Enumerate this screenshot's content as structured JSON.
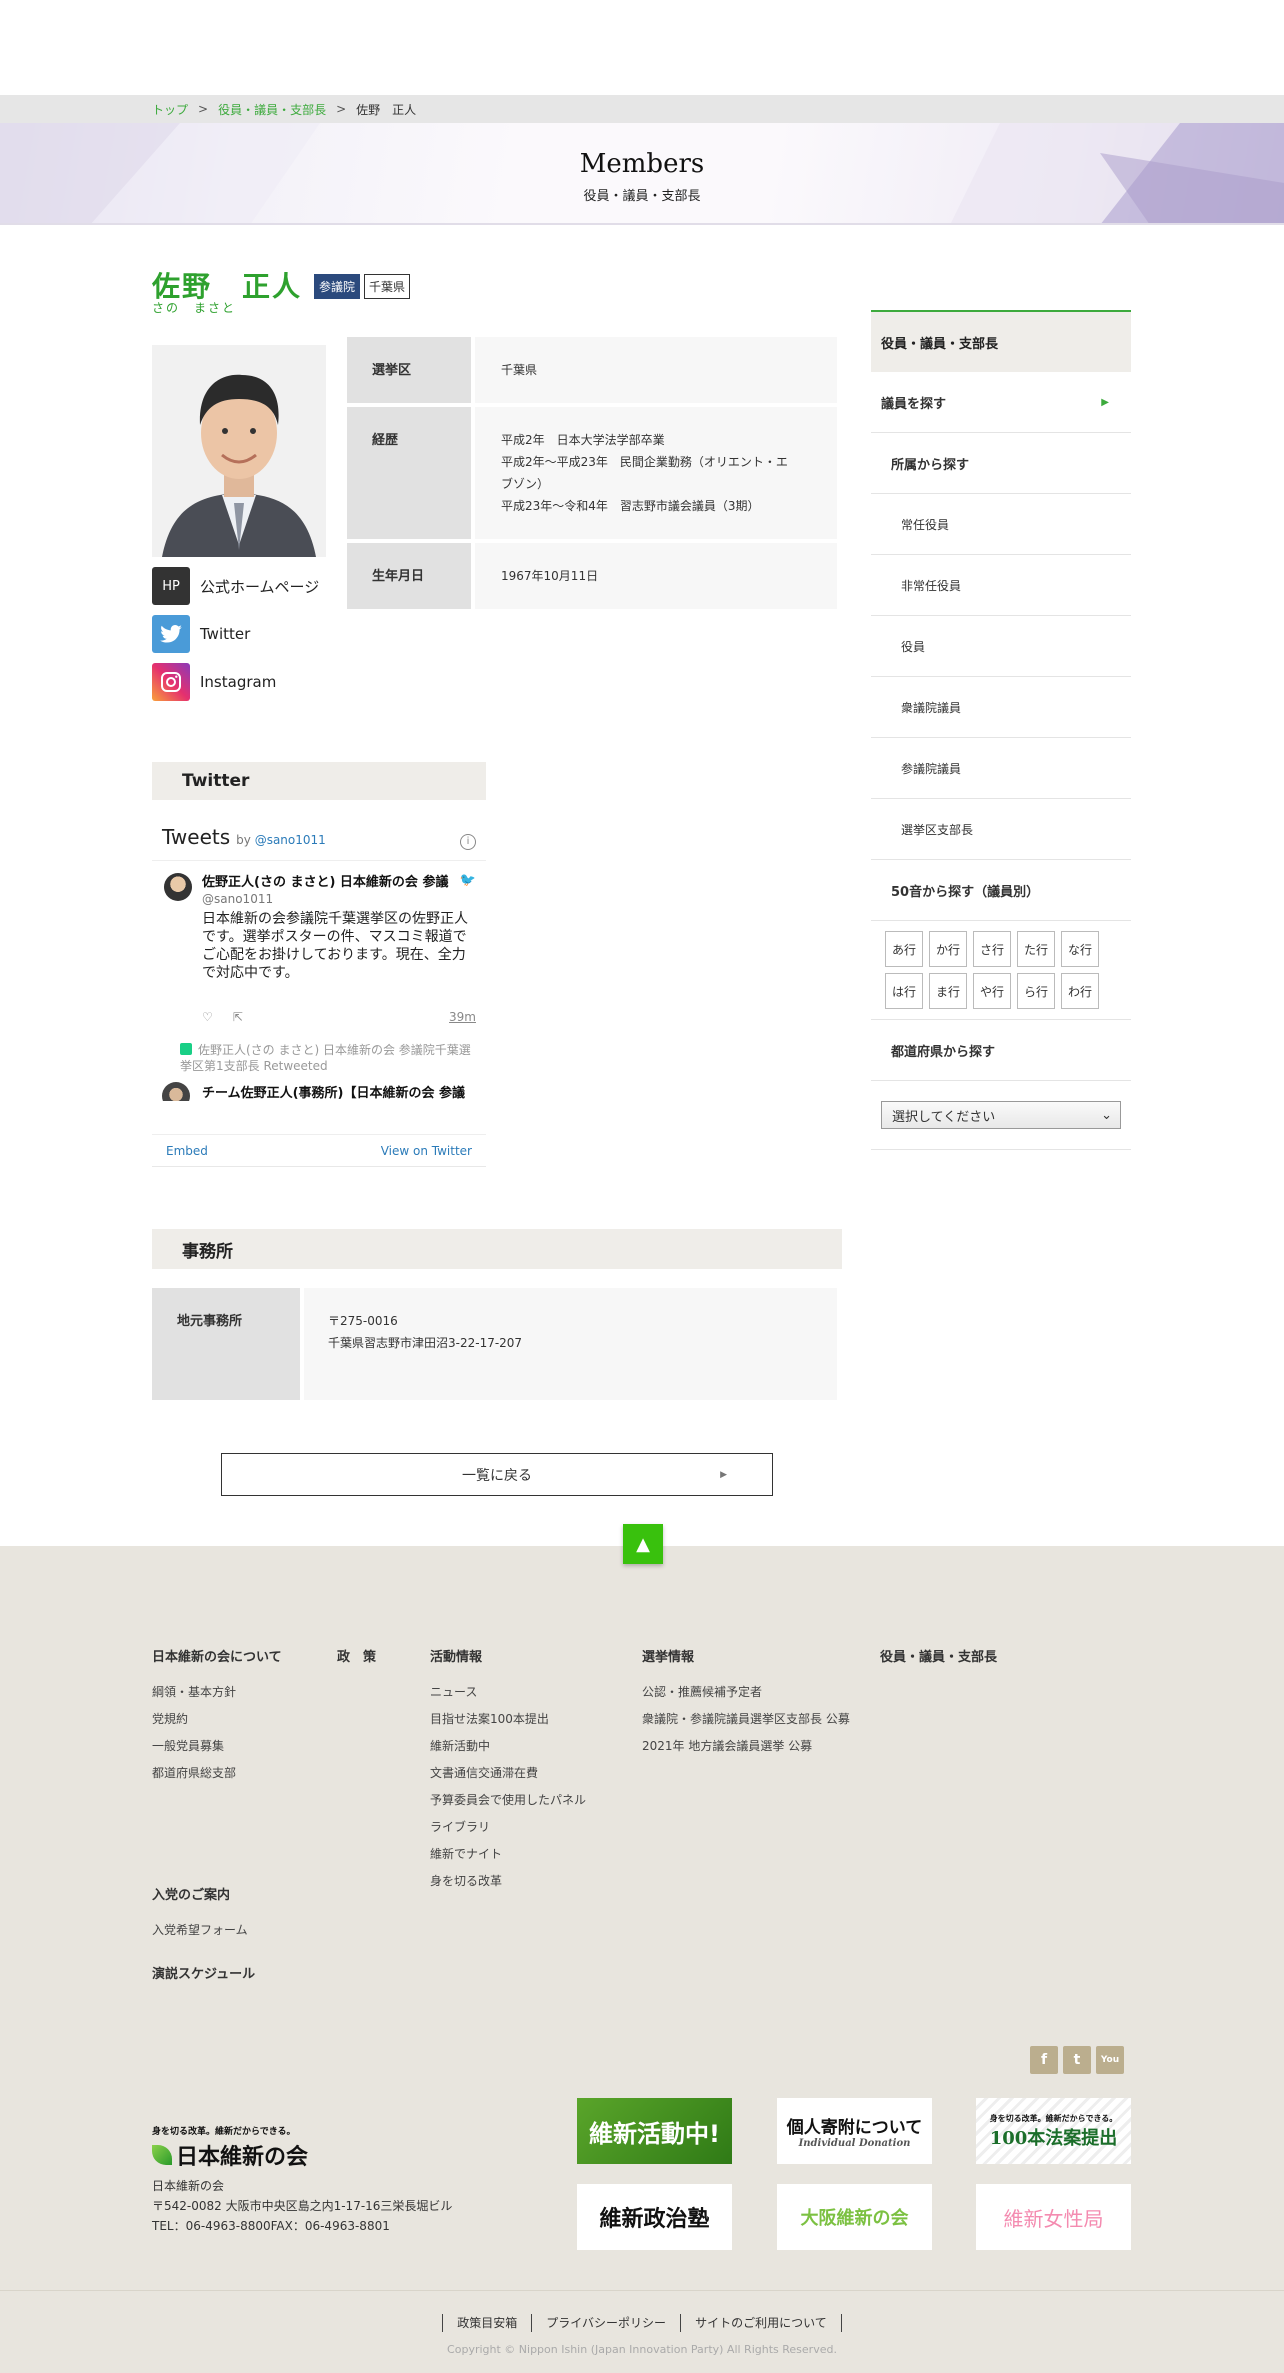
{
  "breadcrumb": {
    "home": "トップ",
    "section": "役員・議員・支部長",
    "current": "佐野　正人",
    "sep": ">"
  },
  "hero": {
    "title": "Members",
    "subtitle": "役員・議員・支部長"
  },
  "profile": {
    "name": "佐野　正人",
    "kana": "さの　まさと",
    "badge_house": "参議院",
    "badge_pref": "千葉県",
    "rows": [
      {
        "label": "選挙区",
        "value": [
          "千葉県"
        ]
      },
      {
        "label": "経歴",
        "value": [
          "平成2年　日本大学法学部卒業",
          "平成2年～平成23年　民間企業勤務（オリエント・エ",
          "ブゾン）",
          "平成23年～令和4年　習志野市議会議員（3期）"
        ]
      },
      {
        "label": "生年月日",
        "value": [
          "1967年10月11日"
        ]
      }
    ],
    "links": [
      {
        "label": "公式ホームページ",
        "icon_text": "HP",
        "color": "#333333"
      },
      {
        "label": "Twitter",
        "icon_text": "🐦",
        "color": "#4a9bd8"
      },
      {
        "label": "Instagram",
        "icon_text": "◎",
        "color": "#c13584"
      }
    ]
  },
  "twitter": {
    "heading": "Twitter",
    "widget_title": "Tweets",
    "by": "by",
    "handle_link": "@sano1011",
    "tweet1": {
      "name": "佐野正人(さの まさと) 日本維新の会 参議",
      "handle": "@sano1011",
      "text": "日本維新の会参議院千葉選挙区の佐野正人です。選挙ポスターの件、マスコミ報道でご心配をお掛けしております。現在、全力で対応中です。",
      "time": "39m"
    },
    "retweet_note": "佐野正人(さの まさと) 日本維新の会 参議院千葉選挙区第1支部長 Retweeted",
    "tweet2_name": "チーム佐野正人(事務所)【日本維新の会 参議",
    "embed": "Embed",
    "view": "View on Twitter"
  },
  "office": {
    "heading": "事務所",
    "label": "地元事務所",
    "postal": "〒275-0016",
    "address": "千葉県習志野市津田沼3-22-17-207"
  },
  "back_button": "一覧に戻る",
  "sidebar": {
    "title": "役員・議員・支部長",
    "search": "議員を探す",
    "by_affiliation": "所属から探す",
    "affiliations": [
      "常任役員",
      "非常任役員",
      "役員",
      "衆議院議員",
      "参議院議員",
      "選挙区支部長"
    ],
    "by_kana": "50音から探す（議員別）",
    "kana": [
      "あ行",
      "か行",
      "さ行",
      "た行",
      "な行",
      "は行",
      "ま行",
      "や行",
      "ら行",
      "わ行"
    ],
    "by_pref": "都道府県から探す",
    "select_placeholder": "選択してください"
  },
  "footer": {
    "col1_title": "日本維新の会について",
    "col1": [
      "綱領・基本方針",
      "党規約",
      "一般党員募集",
      "都道府県総支部"
    ],
    "col2_title": "政　策",
    "col3_title": "活動情報",
    "col3": [
      "ニュース",
      "目指せ法案100本提出",
      "維新活動中",
      "文書通信交通滞在費",
      "予算委員会で使用したパネル",
      "ライブラリ",
      "維新でナイト",
      "身を切る改革"
    ],
    "col4_title": "選挙情報",
    "col4": [
      "公認・推薦候補予定者",
      "衆議院・参議院議員選挙区支部長 公募",
      "2021年 地方議会議員選挙 公募"
    ],
    "col5_title": "役員・議員・支部長",
    "join_title": "入党のご案内",
    "join_link": "入党希望フォーム",
    "speech_title": "演説スケジュール",
    "social": [
      "f",
      "t",
      "You"
    ],
    "logo_tagline": "身を切る改革。維新だからできる。",
    "logo_name": "日本維新の会",
    "org": "日本維新の会",
    "address": "〒542-0082 大阪市中央区島之内1-17-16三栄長堀ビル",
    "tel": "TEL：06-4963-8800FAX：06-4963-8801",
    "banners": [
      "維新活動中!",
      "個人寄附について",
      "Individual Donation",
      "身を切る改革。維新だからできる。",
      "100本法案提出",
      "維新政治塾",
      "大阪維新の会",
      "維新女性局"
    ],
    "bottom_links": [
      "政策目安箱",
      "プライバシーポリシー",
      "サイトのご利用について"
    ],
    "copyright": "Copyright © Nippon Ishin (Japan Innovation Party) All Rights Reserved."
  }
}
